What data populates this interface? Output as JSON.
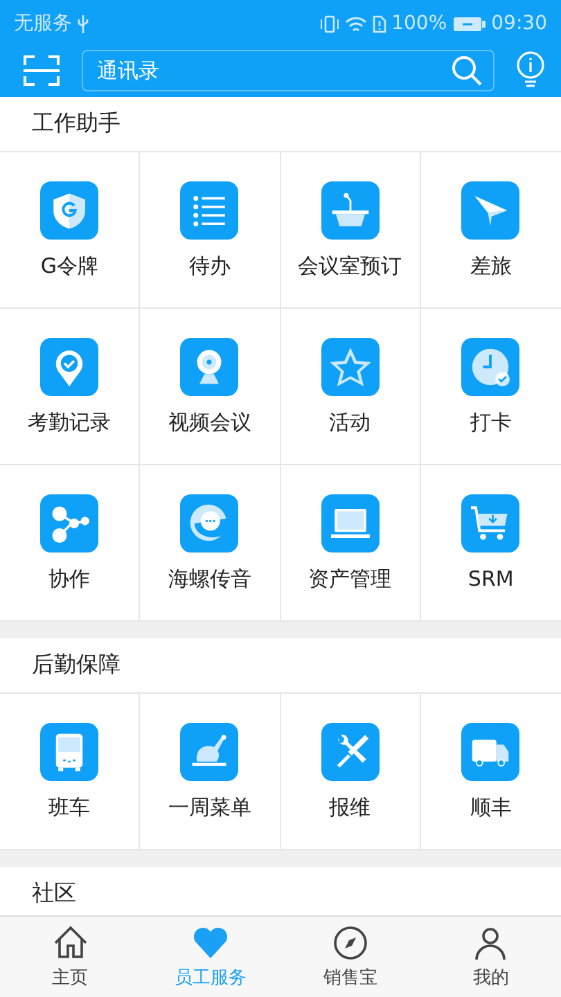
{
  "status_bar": {
    "carrier": "无服务",
    "battery": "100%",
    "time": "09:30"
  },
  "header": {
    "search": {
      "placeholder": "通讯录"
    }
  },
  "sections": [
    {
      "title": "工作助手",
      "items": [
        {
          "label": "G令牌"
        },
        {
          "label": "待办"
        },
        {
          "label": "会议室预订"
        },
        {
          "label": "差旅"
        },
        {
          "label": "考勤记录"
        },
        {
          "label": "视频会议"
        },
        {
          "label": "活动"
        },
        {
          "label": "打卡"
        },
        {
          "label": "协作"
        },
        {
          "label": "海螺传音"
        },
        {
          "label": "资产管理"
        },
        {
          "label": "SRM"
        }
      ]
    },
    {
      "title": "后勤保障",
      "items": [
        {
          "label": "班车"
        },
        {
          "label": "一周菜单"
        },
        {
          "label": "报维"
        },
        {
          "label": "顺丰"
        }
      ]
    },
    {
      "title": "社区"
    }
  ],
  "tab_bar": [
    {
      "label": "主页",
      "selected": false
    },
    {
      "label": "员工服务",
      "selected": true
    },
    {
      "label": "销售宝",
      "selected": false
    },
    {
      "label": "我的",
      "selected": false
    }
  ]
}
